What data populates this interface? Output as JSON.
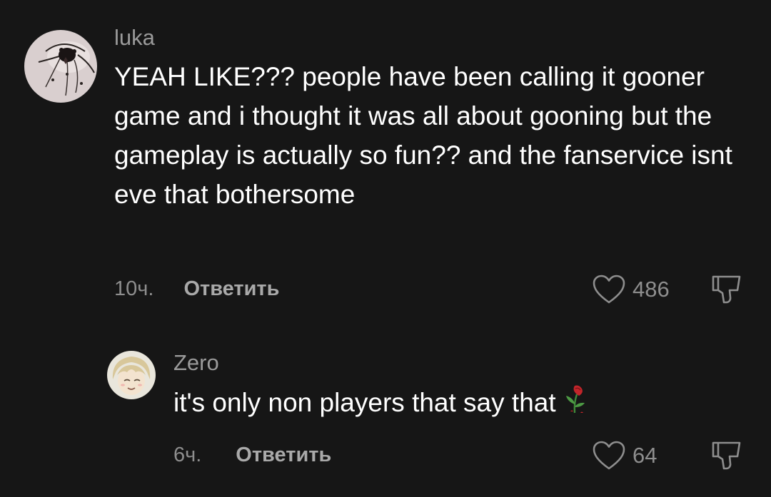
{
  "comments": [
    {
      "username": "luka",
      "avatar_icon": "spider-avatar-icon",
      "text": "YEAH LIKE??? people have been calling it gooner game and i thought it was all about gooning but the gameplay is actually so fun?? and the fanservice isnt eve that bothersome",
      "time": "10ч.",
      "reply_label": "Ответить",
      "likes": "486",
      "like_icon": "heart-outline-icon",
      "dislike_icon": "thumbs-down-icon"
    },
    {
      "username": "Zero",
      "avatar_icon": "anime-character-avatar-icon",
      "text": "it's only non players that say that",
      "emoji": "wilted-rose-emoji",
      "time": "6ч.",
      "reply_label": "Ответить",
      "likes": "64",
      "like_icon": "heart-outline-icon",
      "dislike_icon": "thumbs-down-icon"
    }
  ],
  "colors": {
    "background": "#161616",
    "username": "#9a9a9a",
    "text": "#ffffff",
    "meta": "#8e8e8e",
    "reply": "#a9a9a9"
  }
}
